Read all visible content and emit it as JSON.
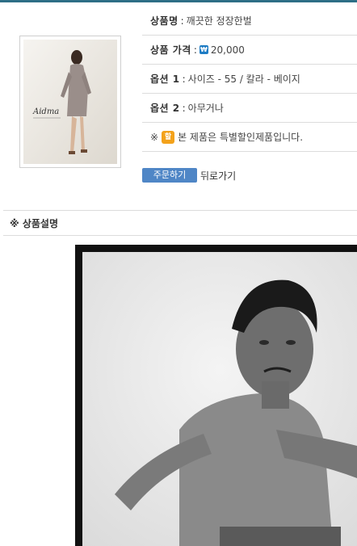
{
  "product": {
    "name_label": "상품명",
    "name_value": "깨끗한 정장한벌",
    "price_label": "상품 가격",
    "price_icon": "won-icon",
    "price_value": "20,000",
    "option1_label": "옵션 1",
    "option1_value": "사이즈 - 55 / 칼라 - 베이지",
    "option2_label": "옵션 2",
    "option2_value": "아무거나",
    "notice_prefix": "※",
    "notice_badge": "할",
    "notice_text": "본 제품은 특별할인제품입니다.",
    "separator": ":"
  },
  "thumbnail": {
    "brand_text": "Aidma"
  },
  "actions": {
    "order_label": "주문하기",
    "back_label": "뒤로가기"
  },
  "description": {
    "heading": "※ 상품설명"
  },
  "colors": {
    "accent": "#2e6e86",
    "button": "#4f86c6",
    "badge": "#f3a21b"
  }
}
